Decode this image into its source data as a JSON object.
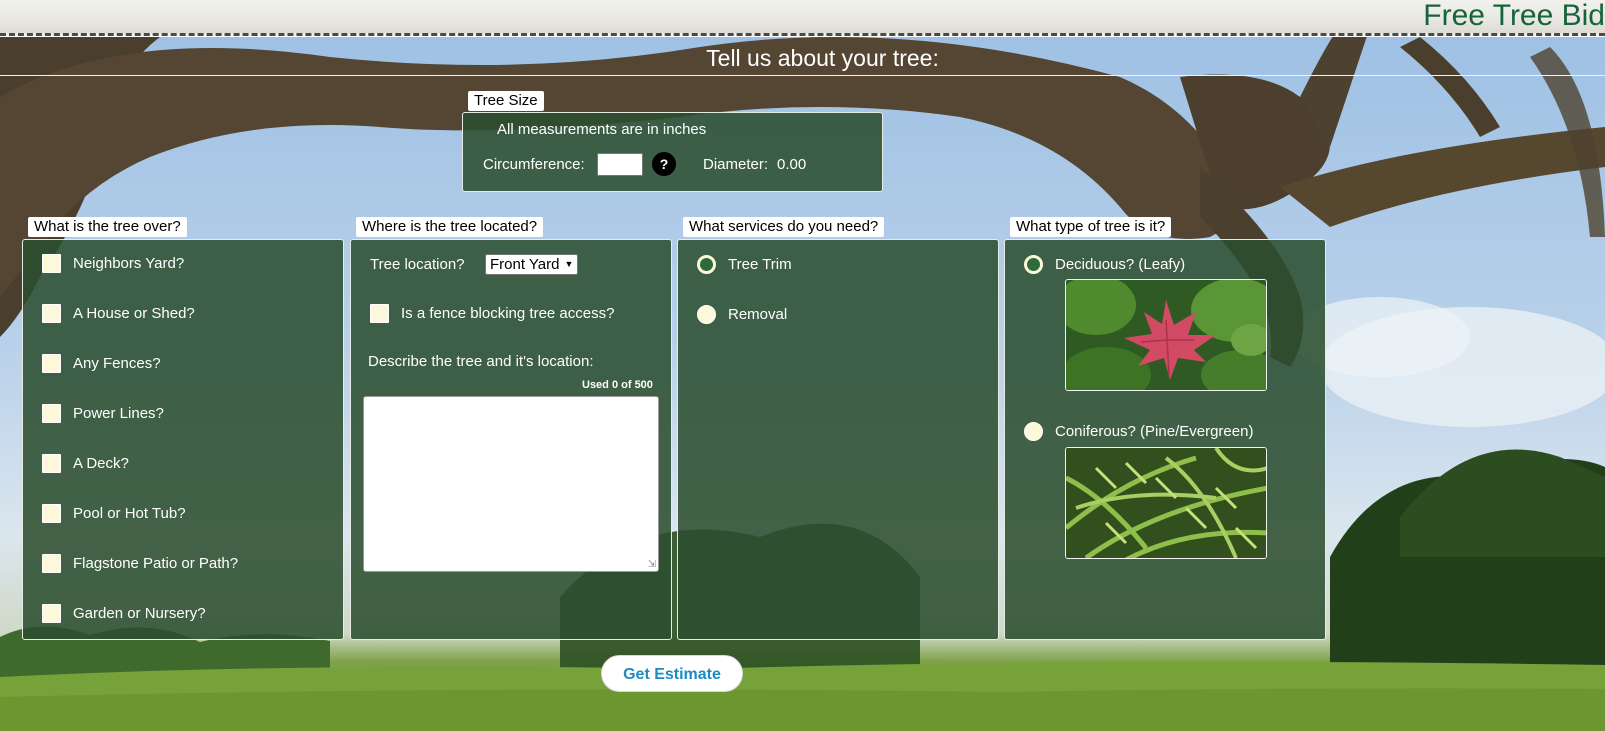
{
  "header": {
    "title": "Free Tree Bid"
  },
  "form": {
    "heading": "Tell us about your tree:"
  },
  "tree_size": {
    "legend": "Tree Size",
    "note": "All measurements are in inches",
    "circumference_label": "Circumference:",
    "circumference_value": "",
    "help_label": "?",
    "diameter_label": "Diameter:",
    "diameter_value": "0.00"
  },
  "over": {
    "legend": "What is the tree over?",
    "items": [
      {
        "label": "Neighbors Yard?",
        "checked": false
      },
      {
        "label": "A House or Shed?",
        "checked": false
      },
      {
        "label": "Any Fences?",
        "checked": false
      },
      {
        "label": "Power Lines?",
        "checked": false
      },
      {
        "label": "A Deck?",
        "checked": false
      },
      {
        "label": "Pool or Hot Tub?",
        "checked": false
      },
      {
        "label": "Flagstone Patio or Path?",
        "checked": false
      },
      {
        "label": "Garden or Nursery?",
        "checked": false
      }
    ]
  },
  "location": {
    "legend": "Where is the tree located?",
    "select_label": "Tree location?",
    "select_value": "Front Yard",
    "fence_label": "Is a fence blocking tree access?",
    "describe_label": "Describe the tree and it's location:",
    "counter": "Used 0 of 500",
    "description": ""
  },
  "services": {
    "legend": "What services do you need?",
    "options": [
      {
        "label": "Tree Trim",
        "selected": true
      },
      {
        "label": "Removal",
        "selected": false
      }
    ]
  },
  "tree_type": {
    "legend": "What type of tree is it?",
    "options": [
      {
        "label": "Deciduous? (Leafy)",
        "selected": true,
        "image": "red-maple-leaf-photo"
      },
      {
        "label": "Coniferous? (Pine/Evergreen)",
        "selected": false,
        "image": "pine-needles-photo"
      }
    ]
  },
  "actions": {
    "submit_label": "Get Estimate"
  },
  "colors": {
    "header_title": "#17643a",
    "panel_bg": "#2c4e30",
    "checkbox_fill": "#fdf8d9",
    "button_text": "#1d8bc2"
  }
}
